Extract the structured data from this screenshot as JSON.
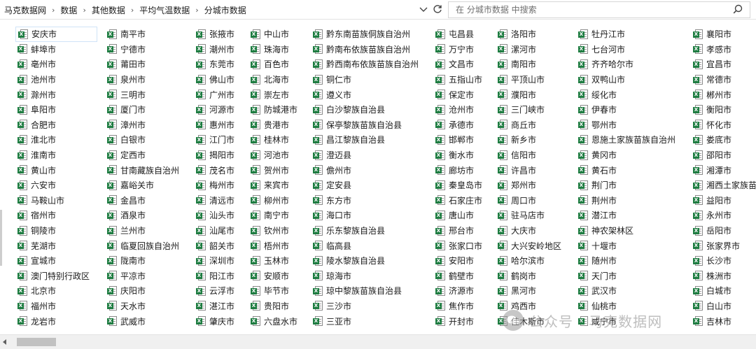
{
  "address": {
    "breadcrumbs": [
      "马克数据网",
      "数据",
      "其他数据",
      "平均气温数据",
      "分城市数据"
    ]
  },
  "search": {
    "placeholder": "在 分城市数据 中搜索"
  },
  "files": [
    [
      "安庆市",
      "蚌埠市",
      "亳州市",
      "池州市",
      "滁州市",
      "阜阳市",
      "合肥市",
      "淮北市",
      "淮南市",
      "黄山市",
      "六安市",
      "马鞍山市",
      "宿州市",
      "铜陵市",
      "芜湖市",
      "宣城市",
      "澳门特别行政区",
      "北京市",
      "福州市",
      "龙岩市"
    ],
    [
      "南平市",
      "宁德市",
      "莆田市",
      "泉州市",
      "三明市",
      "厦门市",
      "漳州市",
      "白银市",
      "定西市",
      "甘南藏族自治州",
      "嘉峪关市",
      "金昌市",
      "酒泉市",
      "兰州市",
      "临夏回族自治州",
      "陇南市",
      "平凉市",
      "庆阳市",
      "天水市",
      "武威市"
    ],
    [
      "张掖市",
      "潮州市",
      "东莞市",
      "佛山市",
      "广州市",
      "河源市",
      "惠州市",
      "江门市",
      "揭阳市",
      "茂名市",
      "梅州市",
      "清远市",
      "汕头市",
      "汕尾市",
      "韶关市",
      "深圳市",
      "阳江市",
      "云浮市",
      "湛江市",
      "肇庆市"
    ],
    [
      "中山市",
      "珠海市",
      "百色市",
      "北海市",
      "崇左市",
      "防城港市",
      "贵港市",
      "桂林市",
      "河池市",
      "贺州市",
      "来宾市",
      "柳州市",
      "南宁市",
      "钦州市",
      "梧州市",
      "玉林市",
      "安顺市",
      "毕节市",
      "贵阳市",
      "六盘水市"
    ],
    [
      "黔东南苗族侗族自治州",
      "黔南布依族苗族自治州",
      "黔西南布依族苗族自治州",
      "铜仁市",
      "遵义市",
      "白沙黎族自治县",
      "保亭黎族苗族自治县",
      "昌江黎族自治县",
      "澄迈县",
      "儋州市",
      "定安县",
      "东方市",
      "海口市",
      "乐东黎族自治县",
      "临高县",
      "陵水黎族自治县",
      "琼海市",
      "琼中黎族苗族自治县",
      "三沙市",
      "三亚市"
    ],
    [
      "屯昌县",
      "万宁市",
      "文昌市",
      "五指山市",
      "保定市",
      "沧州市",
      "承德市",
      "邯郸市",
      "衡水市",
      "廊坊市",
      "秦皇岛市",
      "石家庄市",
      "唐山市",
      "邢台市",
      "张家口市",
      "安阳市",
      "鹤壁市",
      "济源市",
      "焦作市",
      "开封市"
    ],
    [
      "洛阳市",
      "漯河市",
      "南阳市",
      "平顶山市",
      "濮阳市",
      "三门峡市",
      "商丘市",
      "新乡市",
      "信阳市",
      "许昌市",
      "郑州市",
      "周口市",
      "驻马店市",
      "大庆市",
      "大兴安岭地区",
      "哈尔滨市",
      "鹤岗市",
      "黑河市",
      "鸡西市",
      "佳木斯市"
    ],
    [
      "牡丹江市",
      "七台河市",
      "齐齐哈尔市",
      "双鸭山市",
      "绥化市",
      "伊春市",
      "鄂州市",
      "恩施土家族苗族自治州",
      "黄冈市",
      "黄石市",
      "荆门市",
      "荆州市",
      "潜江市",
      "神农架林区",
      "十堰市",
      "随州市",
      "天门市",
      "武汉市",
      "仙桃市",
      "咸宁市"
    ],
    [
      "襄阳市",
      "孝感市",
      "宜昌市",
      "常德市",
      "郴州市",
      "衡阳市",
      "怀化市",
      "娄底市",
      "邵阳市",
      "湘潭市",
      "湘西土家族苗族自治州",
      "益阳市",
      "永州市",
      "岳阳市",
      "张家界市",
      "长沙市",
      "株洲市",
      "白城市",
      "白山市",
      "吉林市"
    ]
  ],
  "watermark": {
    "text": "公众号 · 马克数据网"
  },
  "icons": {
    "file": "excel-file-icon",
    "refresh": "refresh-icon",
    "search": "search-icon",
    "dropdown": "chevron-down-icon"
  },
  "colors": {
    "excel_green": "#1f7d42",
    "selection_border": "#cfe3f7"
  }
}
